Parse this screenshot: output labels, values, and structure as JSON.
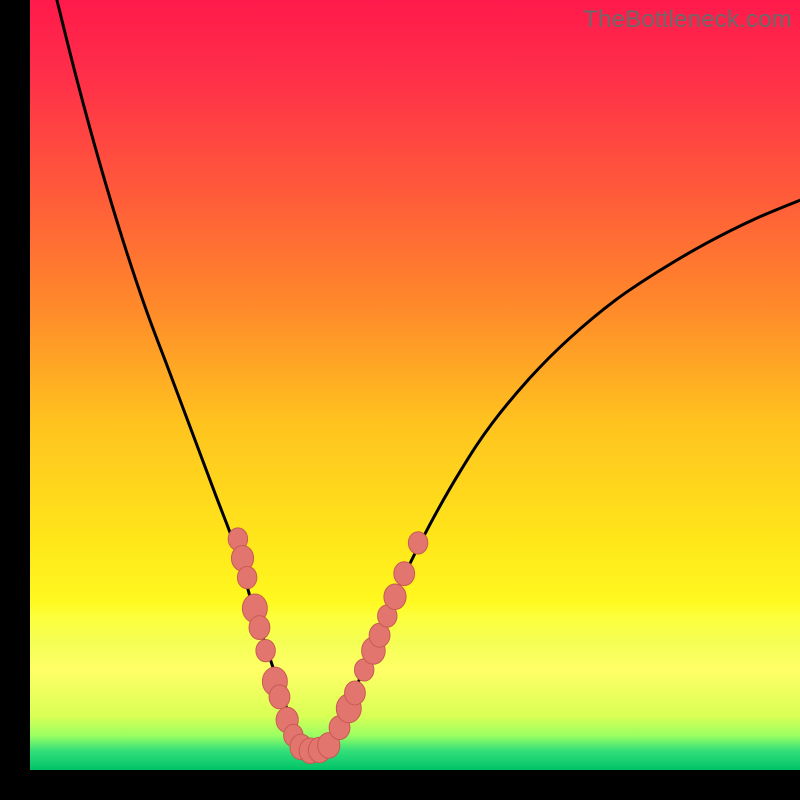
{
  "watermark": "TheBottleneck.com",
  "colors": {
    "frame": "#000000",
    "curve": "#000000",
    "marker_fill": "#e2766f",
    "marker_stroke": "#c85a53",
    "gradient_stops": [
      {
        "offset": 0.0,
        "color": "#ff1a4b"
      },
      {
        "offset": 0.1,
        "color": "#ff2f49"
      },
      {
        "offset": 0.25,
        "color": "#ff5a3a"
      },
      {
        "offset": 0.4,
        "color": "#ff8a2a"
      },
      {
        "offset": 0.55,
        "color": "#ffc31f"
      },
      {
        "offset": 0.7,
        "color": "#ffe61a"
      },
      {
        "offset": 0.78,
        "color": "#fff81f"
      },
      {
        "offset": 0.8,
        "color": "#fdff3a"
      },
      {
        "offset": 0.835,
        "color": "#f4ff55"
      },
      {
        "offset": 0.87,
        "color": "#ffff66"
      },
      {
        "offset": 0.93,
        "color": "#d9ff55"
      },
      {
        "offset": 0.955,
        "color": "#9bff62"
      },
      {
        "offset": 0.975,
        "color": "#33e07a"
      },
      {
        "offset": 1.0,
        "color": "#00c268"
      }
    ]
  },
  "chart_data": {
    "type": "line",
    "title": "",
    "xlabel": "",
    "ylabel": "",
    "x_range": [
      0,
      100
    ],
    "y_range": [
      0,
      100
    ],
    "series": [
      {
        "name": "bottleneck-curve",
        "x": [
          3,
          6,
          9,
          12,
          15,
          18,
          21,
          24,
          27,
          29,
          31,
          33,
          34.5,
          36,
          37.5,
          39.5,
          42,
          45,
          48,
          52,
          56,
          60,
          65,
          70,
          76,
          82,
          88,
          94,
          100
        ],
        "y": [
          102,
          90,
          79,
          69,
          60,
          52,
          44,
          36,
          28,
          21,
          15,
          9,
          5,
          2.5,
          2.5,
          5,
          10,
          17,
          24,
          32,
          39,
          45,
          51,
          56,
          61,
          65,
          68.5,
          71.5,
          74
        ]
      }
    ],
    "markers": {
      "name": "highlighted-points",
      "points": [
        {
          "x": 27.0,
          "y": 30.0,
          "r": 1.4
        },
        {
          "x": 27.6,
          "y": 27.5,
          "r": 1.6
        },
        {
          "x": 28.2,
          "y": 25.0,
          "r": 1.4
        },
        {
          "x": 29.2,
          "y": 21.0,
          "r": 1.8
        },
        {
          "x": 29.8,
          "y": 18.5,
          "r": 1.5
        },
        {
          "x": 30.6,
          "y": 15.5,
          "r": 1.4
        },
        {
          "x": 31.8,
          "y": 11.5,
          "r": 1.8
        },
        {
          "x": 32.4,
          "y": 9.5,
          "r": 1.5
        },
        {
          "x": 33.4,
          "y": 6.5,
          "r": 1.6
        },
        {
          "x": 34.2,
          "y": 4.5,
          "r": 1.4
        },
        {
          "x": 35.2,
          "y": 3.0,
          "r": 1.6
        },
        {
          "x": 36.4,
          "y": 2.5,
          "r": 1.6
        },
        {
          "x": 37.6,
          "y": 2.6,
          "r": 1.6
        },
        {
          "x": 38.8,
          "y": 3.2,
          "r": 1.6
        },
        {
          "x": 40.2,
          "y": 5.5,
          "r": 1.5
        },
        {
          "x": 41.4,
          "y": 8.0,
          "r": 1.8
        },
        {
          "x": 42.2,
          "y": 10.0,
          "r": 1.5
        },
        {
          "x": 43.4,
          "y": 13.0,
          "r": 1.4
        },
        {
          "x": 44.6,
          "y": 15.5,
          "r": 1.7
        },
        {
          "x": 45.4,
          "y": 17.5,
          "r": 1.5
        },
        {
          "x": 46.4,
          "y": 20.0,
          "r": 1.4
        },
        {
          "x": 47.4,
          "y": 22.5,
          "r": 1.6
        },
        {
          "x": 48.6,
          "y": 25.5,
          "r": 1.5
        },
        {
          "x": 50.4,
          "y": 29.5,
          "r": 1.4
        }
      ]
    }
  }
}
